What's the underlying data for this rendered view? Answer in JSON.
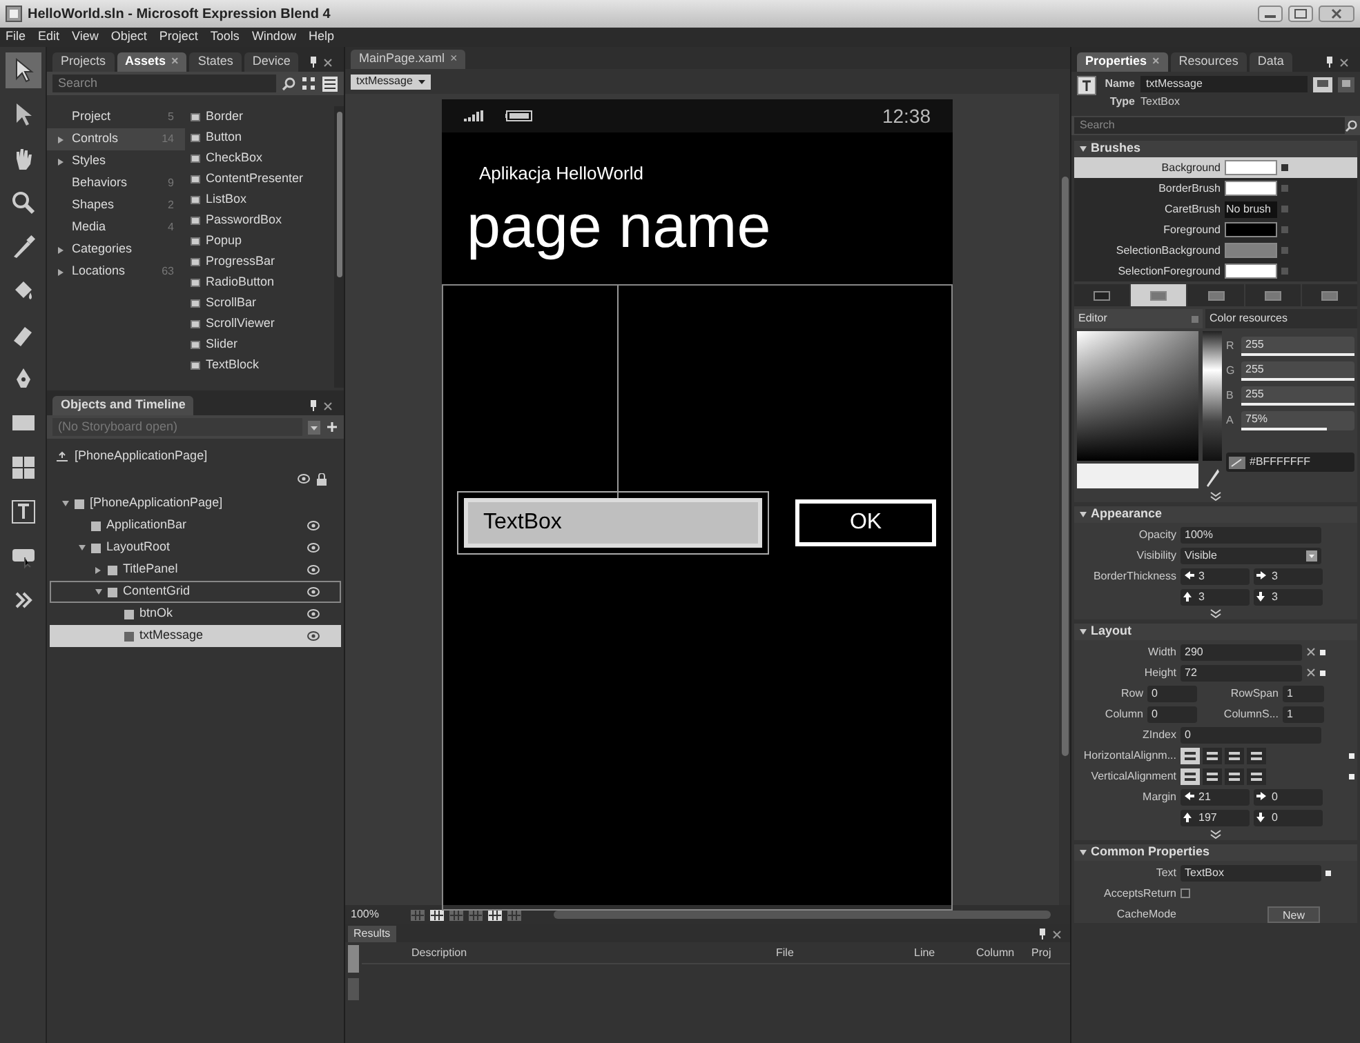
{
  "window": {
    "title": "HelloWorld.sln - Microsoft Expression Blend 4"
  },
  "menu": [
    "File",
    "Edit",
    "View",
    "Object",
    "Project",
    "Tools",
    "Window",
    "Help"
  ],
  "assets_panel": {
    "tabs": [
      {
        "label": "Projects",
        "selected": false
      },
      {
        "label": "Assets",
        "selected": true,
        "close": "×"
      },
      {
        "label": "States",
        "selected": false
      },
      {
        "label": "Device",
        "selected": false
      }
    ],
    "search": {
      "placeholder": "Search"
    },
    "categories": [
      {
        "label": "Project",
        "count": "5",
        "expandable": false,
        "selected": false
      },
      {
        "label": "Controls",
        "count": "14",
        "expandable": true,
        "selected": true
      },
      {
        "label": "Styles",
        "expandable": true,
        "selected": false
      },
      {
        "label": "Behaviors",
        "count": "9",
        "expandable": false,
        "selected": false
      },
      {
        "label": "Shapes",
        "count": "2",
        "expandable": false,
        "selected": false
      },
      {
        "label": "Media",
        "count": "4",
        "expandable": false,
        "selected": false
      },
      {
        "label": "Categories",
        "expandable": true,
        "selected": false
      },
      {
        "label": "Locations",
        "count": "63",
        "expandable": true,
        "selected": false
      }
    ],
    "assets": [
      "Border",
      "Button",
      "CheckBox",
      "ContentPresenter",
      "ListBox",
      "PasswordBox",
      "Popup",
      "ProgressBar",
      "RadioButton",
      "ScrollBar",
      "ScrollViewer",
      "Slider",
      "TextBlock"
    ]
  },
  "objects_panel": {
    "title": "Objects and Timeline",
    "storyboard": {
      "placeholder": "(No Storyboard open)"
    },
    "root": "[PhoneApplicationPage]",
    "tree": [
      {
        "label": "[PhoneApplicationPage]",
        "expanded": true,
        "selected": false,
        "active": false,
        "children": [
          {
            "label": "ApplicationBar",
            "selected": false,
            "active": false
          },
          {
            "label": "LayoutRoot",
            "expanded": true,
            "selected": false,
            "active": false,
            "children": [
              {
                "label": "TitlePanel",
                "expanded": false,
                "selected": false,
                "active": false
              },
              {
                "label": "ContentGrid",
                "expanded": true,
                "selected": false,
                "active": true,
                "children": [
                  {
                    "label": "btnOk",
                    "selected": false,
                    "active": false
                  },
                  {
                    "label": "txtMessage",
                    "selected": true,
                    "active": false
                  }
                ]
              }
            ]
          }
        ]
      }
    ]
  },
  "document": {
    "tab": {
      "label": "MainPage.xaml",
      "close": "×"
    },
    "breadcrumb": "txtMessage",
    "phone": {
      "time": "12:38",
      "app_title": "Aplikacja HelloWorld",
      "page_title": "page name",
      "textbox": "TextBox",
      "button": "OK"
    },
    "zoom": "100%"
  },
  "results": {
    "title": "Results",
    "columns": [
      "Description",
      "File",
      "Line",
      "Column",
      "Proj"
    ]
  },
  "properties": {
    "tabs": [
      {
        "label": "Properties",
        "selected": true,
        "close": "×"
      },
      {
        "label": "Resources",
        "selected": false
      },
      {
        "label": "Data",
        "selected": false
      }
    ],
    "name_label": "Name",
    "name": "txtMessage",
    "type_label": "Type",
    "type": "TextBox",
    "search": {
      "placeholder": "Search"
    },
    "brushes": {
      "title": "Brushes",
      "rows": [
        {
          "label": "Background",
          "color": "#ffffff",
          "selected": true
        },
        {
          "label": "BorderBrush",
          "color": "#ffffff",
          "selected": false
        },
        {
          "label": "CaretBrush",
          "value": "No brush",
          "selected": false
        },
        {
          "label": "Foreground",
          "color": "#000000",
          "selected": false
        },
        {
          "label": "SelectionBackground",
          "color": "#808080",
          "selected": false
        },
        {
          "label": "SelectionForeground",
          "color": "#ffffff",
          "selected": false
        }
      ],
      "brush_types": [
        {
          "selected": false
        },
        {
          "selected": true
        },
        {
          "selected": false
        },
        {
          "selected": false
        },
        {
          "selected": false
        }
      ]
    },
    "editor": {
      "label": "Editor",
      "resources_label": "Color resources",
      "channels": [
        {
          "label": "R",
          "value": "255",
          "level": 1
        },
        {
          "label": "G",
          "value": "255",
          "level": 1
        },
        {
          "label": "B",
          "value": "255",
          "level": 1
        },
        {
          "label": "A",
          "value": "75%",
          "level": 0.75
        }
      ],
      "hex": "#BFFFFFFF"
    },
    "appearance": {
      "title": "Appearance",
      "opacity": {
        "label": "Opacity",
        "value": "100%"
      },
      "visibility": {
        "label": "Visibility",
        "value": "Visible"
      },
      "border_thickness": {
        "label": "BorderThickness",
        "values": [
          "3",
          "3",
          "3",
          "3"
        ]
      }
    },
    "layout": {
      "title": "Layout",
      "width": {
        "label": "Width",
        "value": "290"
      },
      "height": {
        "label": "Height",
        "value": "72"
      },
      "row": {
        "label": "Row",
        "value": "0"
      },
      "row_span": {
        "label": "RowSpan",
        "value": "1"
      },
      "column": {
        "label": "Column",
        "value": "0"
      },
      "column_span": {
        "label": "ColumnS...",
        "value": "1"
      },
      "z_index": {
        "label": "ZIndex",
        "value": "0"
      },
      "horizontal_alignment": {
        "label": "HorizontalAlignm...",
        "options": [
          {
            "selected": true
          },
          {
            "selected": false
          },
          {
            "selected": false
          },
          {
            "selected": false
          }
        ]
      },
      "vertical_alignment": {
        "label": "VerticalAlignment",
        "options": [
          {
            "selected": true
          },
          {
            "selected": false
          },
          {
            "selected": false
          },
          {
            "selected": false
          }
        ]
      },
      "margin": {
        "label": "Margin",
        "values": [
          "21",
          "0",
          "197",
          "0"
        ]
      }
    },
    "common": {
      "title": "Common Properties",
      "text": {
        "label": "Text",
        "value": "TextBox"
      },
      "accepts_return": {
        "label": "AcceptsReturn",
        "checked": false
      },
      "cache_mode": {
        "label": "CacheMode",
        "button": "New"
      }
    }
  }
}
